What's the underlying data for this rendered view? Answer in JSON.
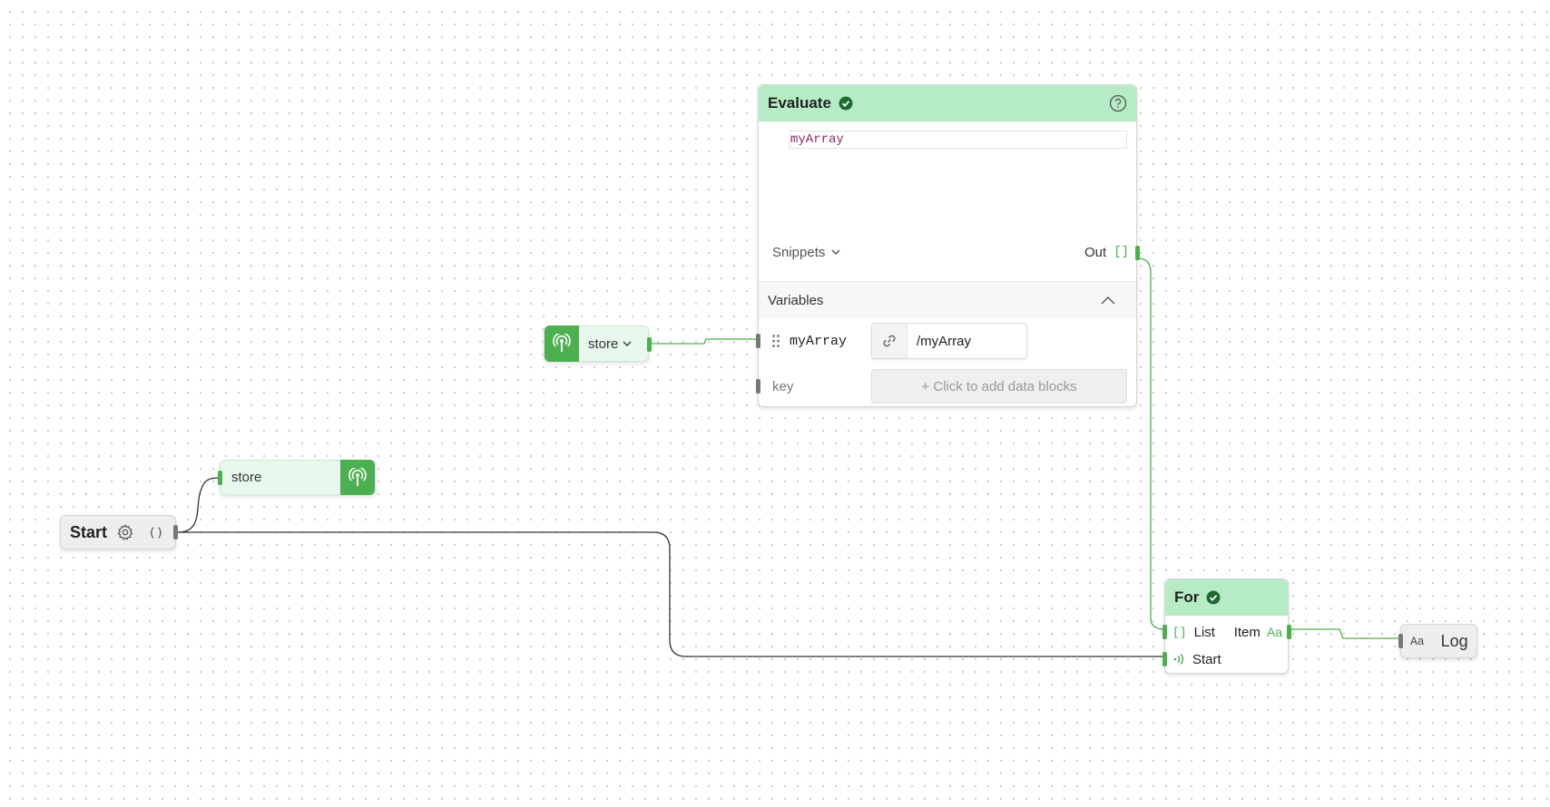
{
  "colors": {
    "accent": "#4caf50",
    "header_bg": "#b5ecc6",
    "store_bg": "#e8f8ec",
    "code_text": "#8b2a6c",
    "wire_dark": "#333333",
    "wire_green": "#4caf50"
  },
  "start_node": {
    "title": "Start",
    "settings_icon": "gear-icon",
    "output_label": "()"
  },
  "store_setter": {
    "label": "store",
    "icon": "broadcast-antenna-icon"
  },
  "store_getter": {
    "label": "store",
    "icon": "broadcast-antenna-icon",
    "dropdown_icon": "chevron-down-icon"
  },
  "evaluate_node": {
    "title": "Evaluate",
    "status_icon": "check-circle-icon",
    "help_icon": "help-circle-icon",
    "code": "myArray",
    "snippets_label": "Snippets",
    "output_label": "Out",
    "output_type": "[]",
    "variables_label": "Variables",
    "variables": [
      {
        "name": "myArray",
        "binding": "/myArray"
      }
    ],
    "new_variable": {
      "placeholder": "key",
      "add_label": "+ Click to add data blocks"
    }
  },
  "for_node": {
    "title": "For",
    "status_icon": "check-circle-icon",
    "list_type": "[]",
    "list_label": "List",
    "item_label": "Item",
    "item_type": "Aa",
    "start_label": "Start"
  },
  "log_node": {
    "input_type": "Aa",
    "title": "Log"
  }
}
